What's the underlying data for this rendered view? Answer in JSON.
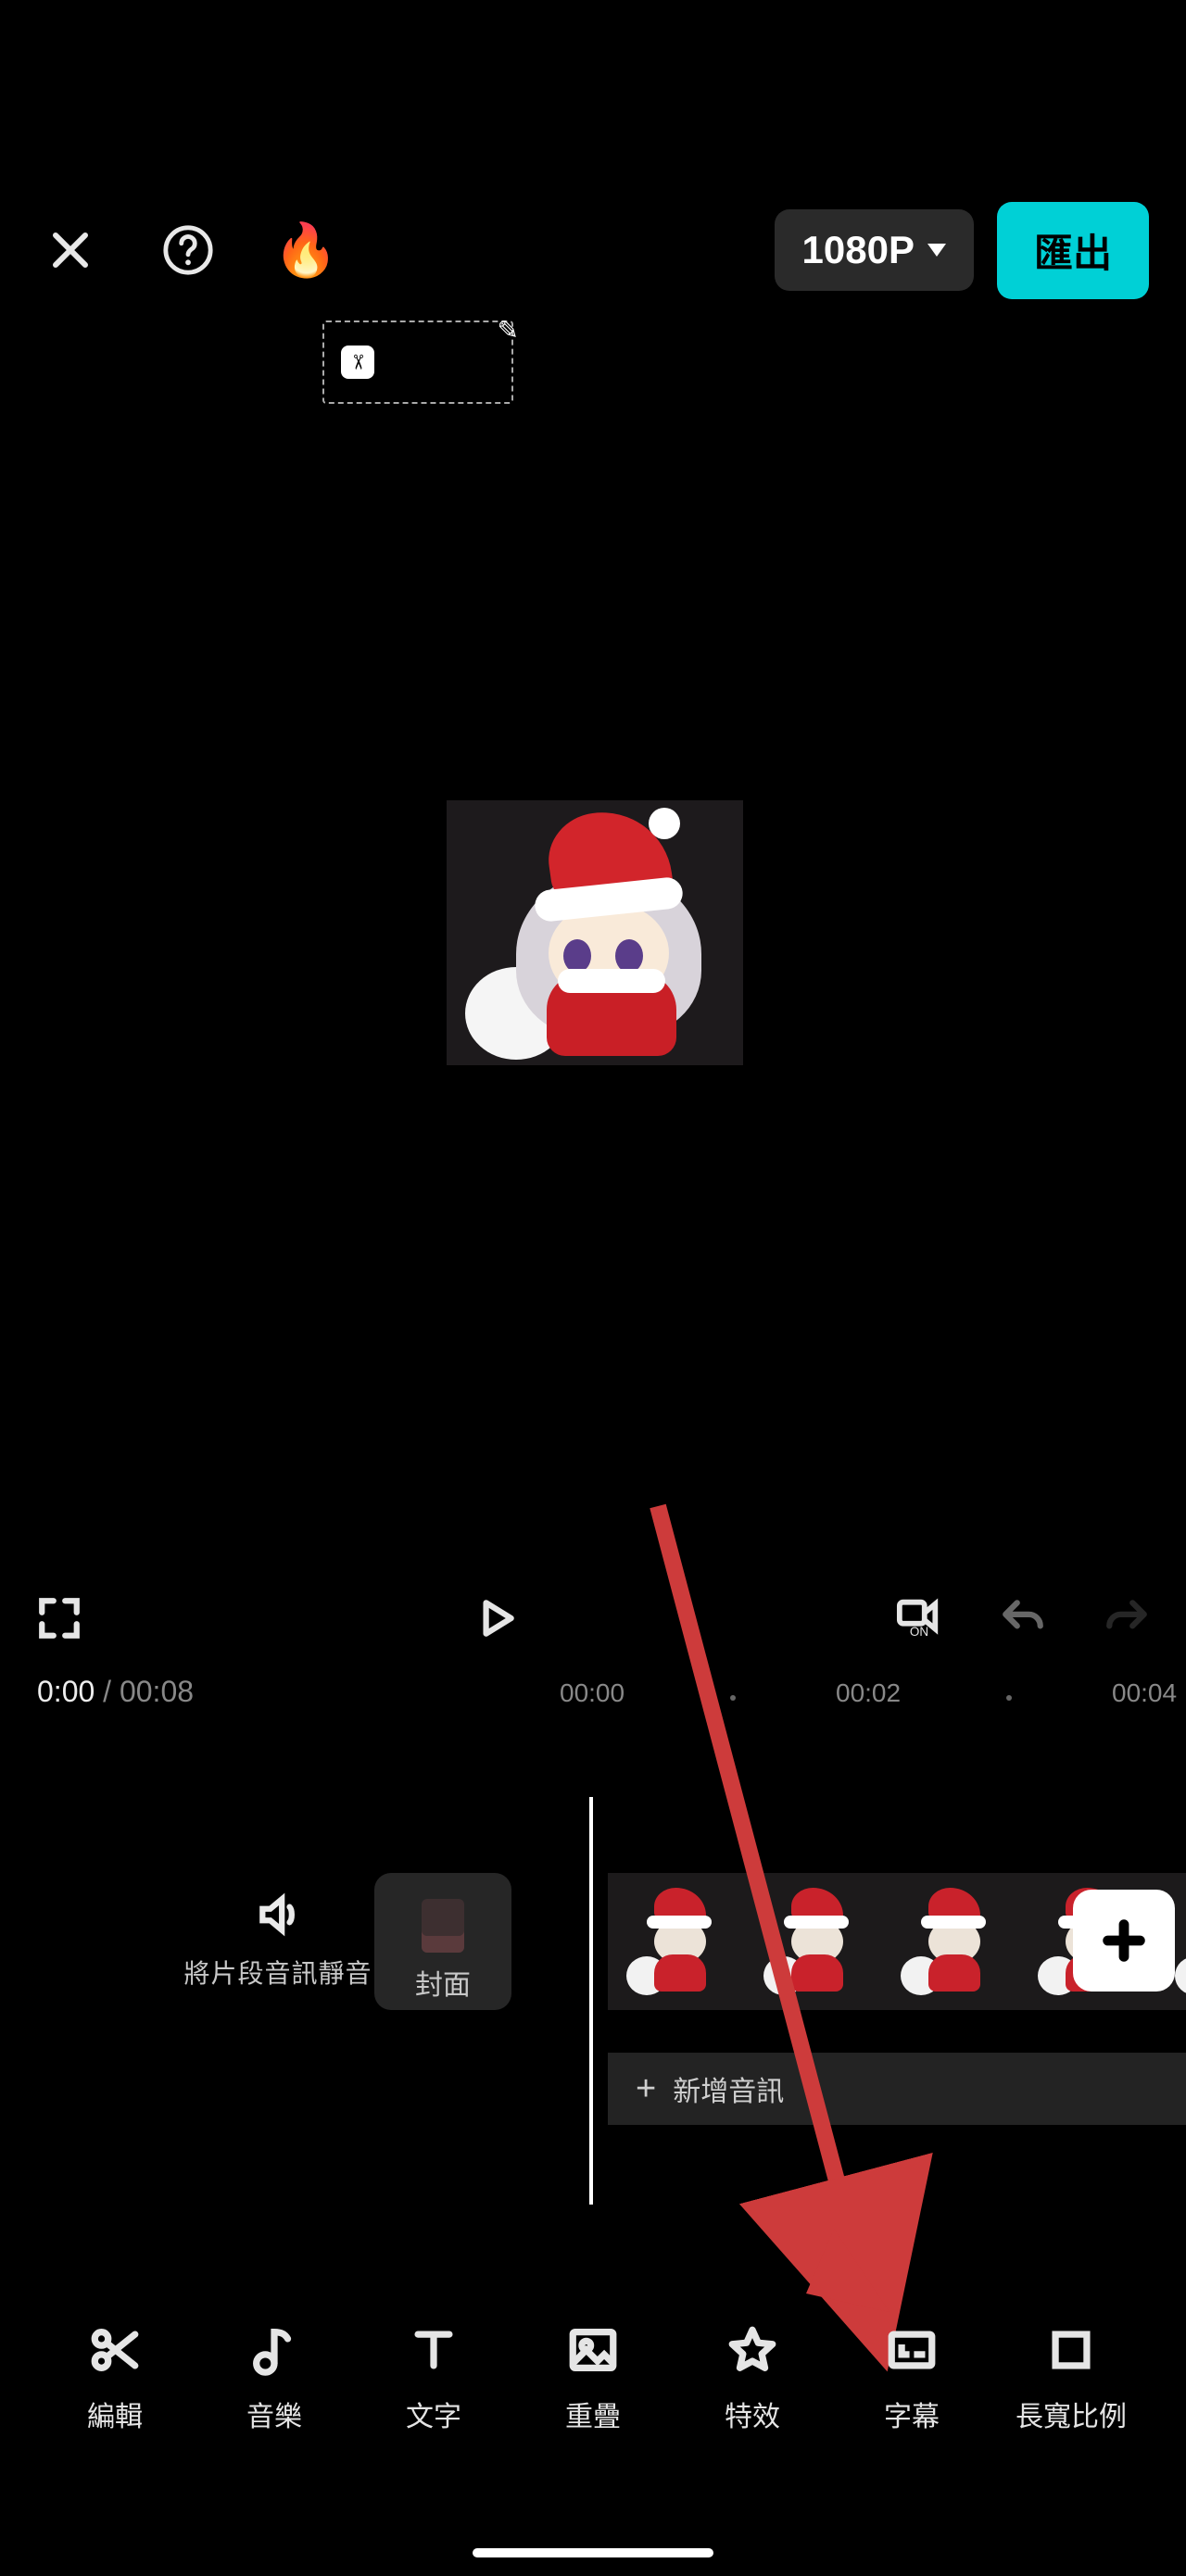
{
  "topbar": {
    "resolution_label": "1080P",
    "export_label": "匯出"
  },
  "preview": {
    "watermark_edit_glyph": "✎"
  },
  "transport": {
    "current_time": "0:00",
    "total_time": "00:08"
  },
  "ruler": {
    "t0": "00:00",
    "t2": "00:02",
    "t4": "00:04"
  },
  "timeline": {
    "mute_label": "將片段音訊靜音",
    "cover_label": "封面",
    "add_audio_label": "新增音訊",
    "add_audio_plus": "+"
  },
  "toolbar": {
    "edit": "編輯",
    "music": "音樂",
    "text": "文字",
    "overlay": "重疊",
    "effects": "特效",
    "subtitle": "字幕",
    "ratio": "長寬比例"
  }
}
